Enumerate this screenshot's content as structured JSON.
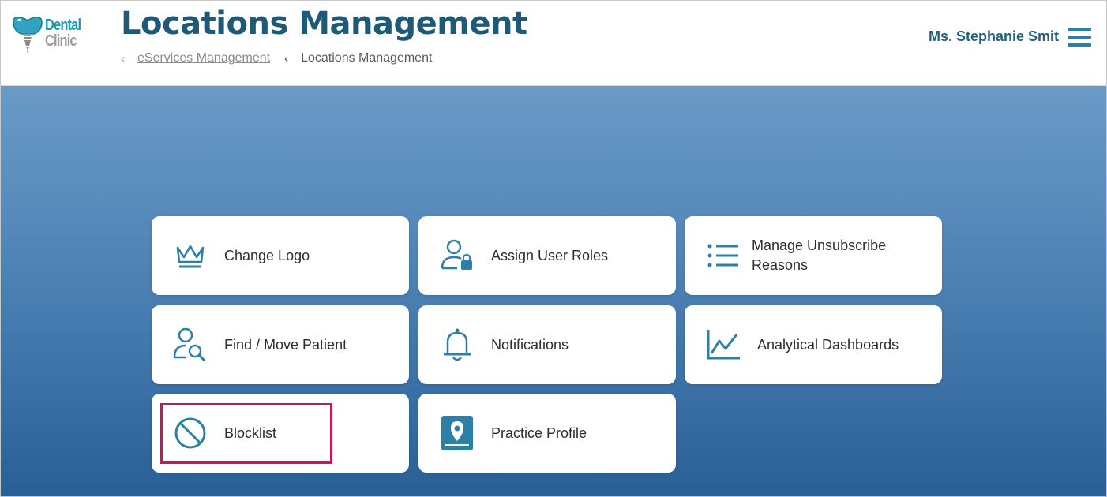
{
  "header": {
    "logo_line1": "Dental",
    "logo_line2": "Clinic",
    "title": "Locations Management",
    "breadcrumb": {
      "parent": "eServices Management",
      "current": "Locations Management"
    },
    "user_name": "Ms. Stephanie Smit"
  },
  "cards": [
    {
      "label": "Change Logo",
      "icon": "crown-icon"
    },
    {
      "label": "Assign User Roles",
      "icon": "user-lock-icon"
    },
    {
      "label": "Manage Unsubscribe Reasons",
      "icon": "list-icon"
    },
    {
      "label": "Find / Move Patient",
      "icon": "user-search-icon"
    },
    {
      "label": "Notifications",
      "icon": "bell-icon"
    },
    {
      "label": "Analytical Dashboards",
      "icon": "line-chart-icon"
    },
    {
      "label": "Blocklist",
      "icon": "block-icon"
    },
    {
      "label": "Practice Profile",
      "icon": "location-pin-icon"
    }
  ],
  "colors": {
    "title": "#1e5a78",
    "icon": "#2b7fa8",
    "highlight": "#cc1458",
    "hero_top": "#6a9bc7",
    "hero_bottom": "#2a5f96"
  }
}
